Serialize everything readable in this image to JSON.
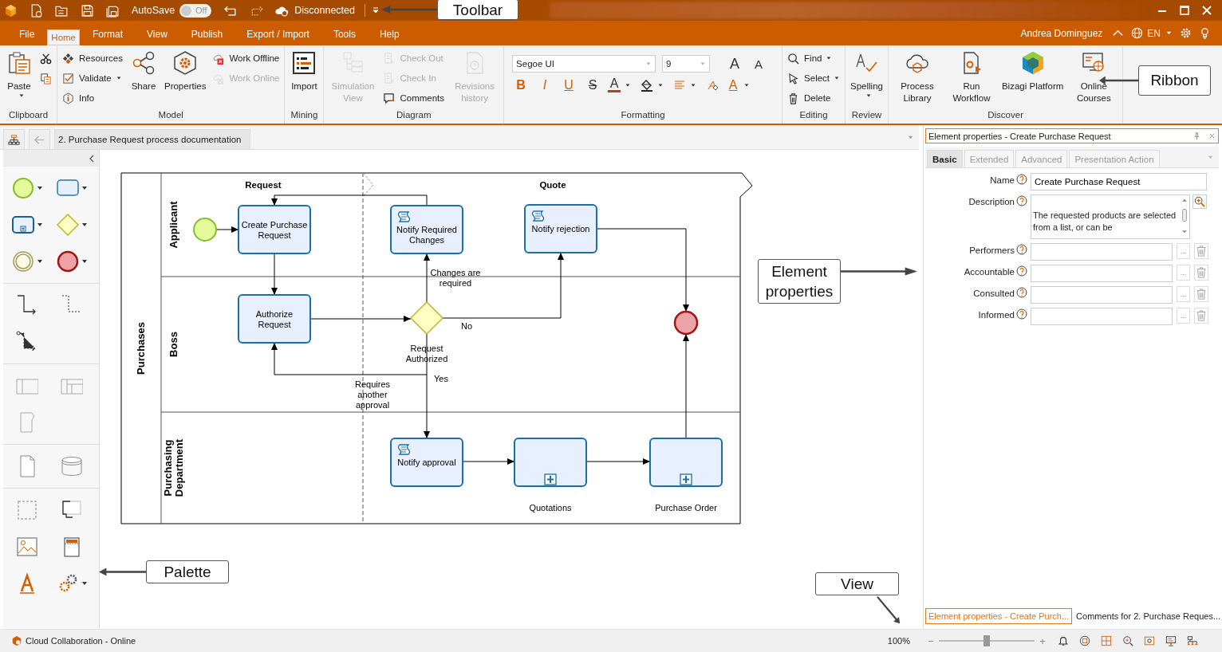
{
  "toolbar": {
    "autosave_label": "AutoSave",
    "autosave": {
      "on": false,
      "label": "Off"
    },
    "connection": "Disconnected"
  },
  "menu_tabs": [
    {
      "label": "File",
      "selected": false
    },
    {
      "label": "Home",
      "selected": true
    },
    {
      "label": "Format",
      "selected": false
    },
    {
      "label": "View",
      "selected": false
    },
    {
      "label": "Publish",
      "selected": false
    },
    {
      "label": "Export / Import",
      "selected": false
    },
    {
      "label": "Tools",
      "selected": false
    },
    {
      "label": "Help",
      "selected": false
    }
  ],
  "user": {
    "name": "Andrea Dominguez",
    "language": "EN"
  },
  "ribbon": [
    {
      "kind": "buttons",
      "label": "Clipboard",
      "items": [
        {
          "kind": "large",
          "label": "Paste",
          "dropdown": true,
          "disabled": false
        },
        {
          "kind": "small",
          "dropdown": false,
          "disabled": false
        },
        {
          "kind": "small",
          "dropdown": false,
          "disabled": false
        }
      ]
    },
    {
      "kind": "buttons",
      "label": "Model",
      "items": [
        {
          "kind": "small",
          "label": "Resources",
          "dropdown": false,
          "disabled": false
        },
        {
          "kind": "small",
          "label": "Validate",
          "dropdown": true,
          "disabled": false
        },
        {
          "kind": "small",
          "label": "Info",
          "dropdown": false,
          "disabled": false
        },
        {
          "kind": "large",
          "label": "Share",
          "dropdown": false,
          "disabled": false
        },
        {
          "kind": "large",
          "label": "Properties",
          "dropdown": false,
          "disabled": false
        },
        {
          "kind": "small",
          "label": "Work Offline",
          "dropdown": false,
          "disabled": false
        },
        {
          "kind": "small",
          "label": "Work Online",
          "dropdown": false,
          "disabled": true
        }
      ]
    },
    {
      "kind": "buttons",
      "label": "Mining",
      "items": [
        {
          "kind": "large",
          "label": "Import",
          "dropdown": false,
          "disabled": false
        }
      ]
    },
    {
      "kind": "buttons",
      "label": "Diagram",
      "items": [
        {
          "kind": "large",
          "label": "Simulation View",
          "dropdown": false,
          "disabled": true
        },
        {
          "kind": "small",
          "label": "Check Out",
          "dropdown": false,
          "disabled": true
        },
        {
          "kind": "small",
          "label": "Check In",
          "dropdown": false,
          "disabled": true
        },
        {
          "kind": "small",
          "label": "Comments",
          "dropdown": false,
          "disabled": false
        },
        {
          "kind": "large",
          "label": "Revisions history",
          "dropdown": false,
          "disabled": true
        }
      ]
    },
    {
      "kind": "formatting",
      "label": "Formatting",
      "font": "Segoe UI",
      "size": "9",
      "grow": "A",
      "shrink": "A",
      "styles": [
        "B",
        "I",
        "U",
        "S"
      ],
      "colors": [
        "A",
        "A"
      ]
    },
    {
      "kind": "buttons",
      "label": "Editing",
      "items": [
        {
          "kind": "small",
          "label": "Find",
          "dropdown": true,
          "disabled": false
        },
        {
          "kind": "small",
          "label": "Select",
          "dropdown": true,
          "disabled": false
        },
        {
          "kind": "small",
          "label": "Delete",
          "dropdown": false,
          "disabled": false
        }
      ]
    },
    {
      "kind": "buttons",
      "label": "Review",
      "items": [
        {
          "kind": "large",
          "label": "Spelling",
          "dropdown": true,
          "disabled": false
        }
      ]
    },
    {
      "kind": "buttons",
      "label": "Discover",
      "items": [
        {
          "kind": "large",
          "label": "Process Library",
          "dropdown": false,
          "disabled": false
        },
        {
          "kind": "large",
          "label": "Run Workflow",
          "dropdown": false,
          "disabled": false
        },
        {
          "kind": "large",
          "label": "Bizagi Platform",
          "dropdown": false,
          "disabled": false
        },
        {
          "kind": "large",
          "label": "Online Courses",
          "dropdown": false,
          "disabled": false
        }
      ]
    }
  ],
  "document_tab": "2. Purchase Request process documentation",
  "diagram": {
    "pool": "Purchases",
    "lanes": [
      "Applicant",
      "Boss",
      "Purchasing Department"
    ],
    "phases": [
      "Request",
      "Quote"
    ],
    "tasks": [
      {
        "kind": "task",
        "name": "Create Purchase Request"
      },
      {
        "kind": "script",
        "name": "Notify Required Changes"
      },
      {
        "kind": "script",
        "name": "Notify rejection"
      },
      {
        "kind": "task",
        "name": "Authorize Request"
      },
      {
        "kind": "script",
        "name": "Notify approval"
      },
      {
        "kind": "subprocess",
        "name": "Quotations"
      },
      {
        "kind": "subprocess",
        "name": "Purchase Order"
      }
    ],
    "gateway": "Request Authorized",
    "flow_labels": [
      "Changes are required",
      "No",
      "Requires another approval",
      "Yes"
    ]
  },
  "properties": {
    "title": "Element properties - Create Purchase Request",
    "tabs": [
      {
        "label": "Basic",
        "selected": true
      },
      {
        "label": "Extended",
        "selected": false
      },
      {
        "label": "Advanced",
        "selected": false
      },
      {
        "label": "Presentation Action",
        "selected": false
      }
    ],
    "fields": [
      {
        "kind": "text",
        "label": "Name",
        "value": "Create Purchase Request"
      },
      {
        "kind": "multiline",
        "label": "Description",
        "value": "The requested products are selected from a list, or can be"
      },
      {
        "kind": "picker",
        "label": "Performers",
        "browse": "..."
      },
      {
        "kind": "picker",
        "label": "Accountable",
        "browse": "..."
      },
      {
        "kind": "picker",
        "label": "Consulted",
        "browse": "..."
      },
      {
        "kind": "picker",
        "label": "Informed",
        "browse": "..."
      }
    ]
  },
  "panel_tabs": [
    {
      "label": "Element properties - Create Purch...",
      "selected": true
    },
    {
      "label": "Comments for 2. Purchase Reques...",
      "selected": false
    }
  ],
  "status": {
    "text": "Cloud Collaboration - Online",
    "zoom": "100%",
    "zoom_minus": "−",
    "zoom_plus": "+",
    "zoom_slider": {
      "level": 0.5
    }
  },
  "annotations": [
    {
      "text": "Toolbar"
    },
    {
      "text": "Ribbon"
    },
    {
      "text": "Element properties"
    },
    {
      "text": "Palette"
    },
    {
      "text": "View"
    }
  ]
}
